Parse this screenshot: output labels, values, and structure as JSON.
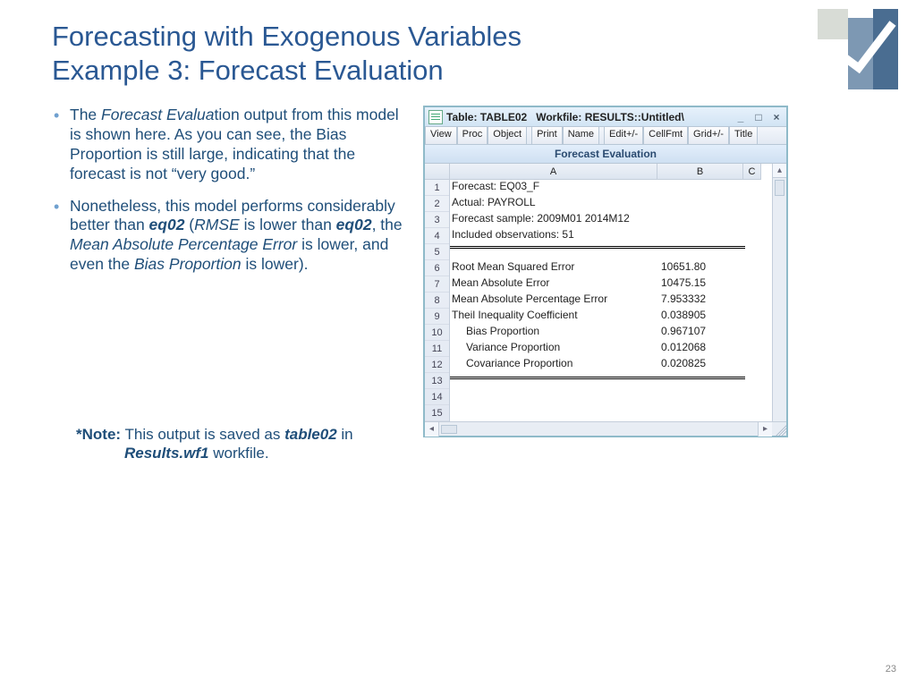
{
  "title_line1": "Forecasting with Exogenous Variables",
  "title_line2": "Example 3: Forecast Evaluation",
  "page_number": "23",
  "bullets": {
    "b1_a": "The ",
    "b1_em": "Forecast Evalua",
    "b1_b": "tion output from this model is shown here. As you can see, the Bias Proportion is still large, indicating that the forecast is not “very good.”",
    "b2_a": "Nonetheless, this model performs considerably better than ",
    "b2_eq02a": "eq02",
    "b2_b": " (",
    "b2_rmse": "RMSE",
    "b2_c": " is lower than ",
    "b2_eq02b": "eq02",
    "b2_d": ", the ",
    "b2_mape": "Mean Absolute Percentage Error",
    "b2_e": " is lower, and even the ",
    "b2_bias": "Bias Proportion",
    "b2_f": " is lower)."
  },
  "note": {
    "lead": "*Note:",
    "a": " This output is saved as ",
    "tbl": "table02",
    "b": " in ",
    "wf": "Results.wf1",
    "c": " workfile."
  },
  "window": {
    "title": "Table: TABLE02   Workfile: RESULTS::Untitled\\",
    "toolbar": [
      "View",
      "Proc",
      "Object",
      "Print",
      "Name",
      "Edit+/-",
      "CellFmt",
      "Grid+/-",
      "Title"
    ],
    "subheader": "Forecast Evaluation",
    "col_headers": [
      "A",
      "B",
      "C"
    ],
    "rows": [
      {
        "n": "1",
        "a": "Forecast: EQ03_F",
        "b": ""
      },
      {
        "n": "2",
        "a": "Actual: PAYROLL",
        "b": ""
      },
      {
        "n": "3",
        "a": "Forecast sample: 2009M01 2014M12",
        "b": ""
      },
      {
        "n": "4",
        "a": "Included observations: 51",
        "b": ""
      },
      {
        "n": "5",
        "a": "",
        "b": ""
      },
      {
        "n": "6",
        "a": "Root Mean Squared Error",
        "b": "10651.80"
      },
      {
        "n": "7",
        "a": "Mean Absolute Error",
        "b": "10475.15"
      },
      {
        "n": "8",
        "a": "Mean Absolute Percentage Error",
        "b": "7.953332"
      },
      {
        "n": "9",
        "a": "Theil Inequality Coefficient",
        "b": "0.038905"
      },
      {
        "n": "10",
        "a": "Bias Proportion",
        "b": "0.967107",
        "indent": true
      },
      {
        "n": "11",
        "a": "Variance Proportion",
        "b": "0.012068",
        "indent": true
      },
      {
        "n": "12",
        "a": "Covariance Proportion",
        "b": "0.020825",
        "indent": true
      },
      {
        "n": "13",
        "a": "",
        "b": ""
      },
      {
        "n": "14",
        "a": "",
        "b": ""
      },
      {
        "n": "15",
        "a": "",
        "b": ""
      }
    ],
    "controls": {
      "min": "_",
      "max": "□",
      "close": "×"
    }
  }
}
